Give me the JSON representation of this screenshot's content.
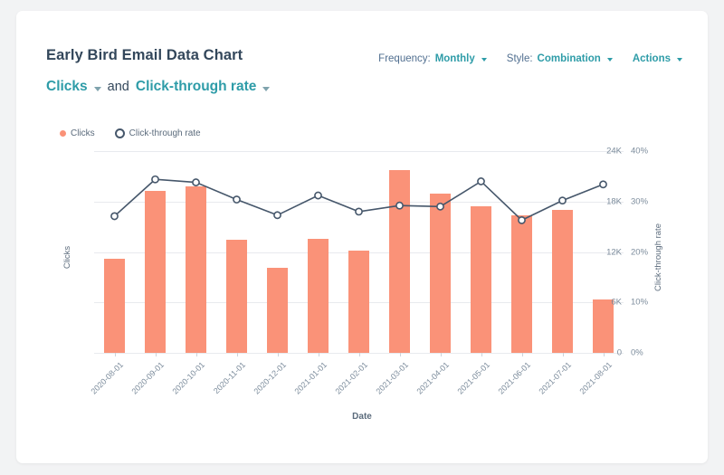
{
  "card": {
    "title": "Early Bird Email Data Chart"
  },
  "controls": [
    {
      "name": "frequency",
      "label": "Frequency:",
      "value": "Monthly",
      "icon": "chevron-down-icon"
    },
    {
      "name": "style",
      "label": "Style:",
      "value": "Combination",
      "icon": "chevron-down-icon"
    },
    {
      "name": "actions",
      "label": "",
      "value": "Actions",
      "icon": "chevron-down-icon"
    }
  ],
  "metrics": {
    "primary": "Clicks",
    "conjunction": "and",
    "secondary": "Click-through rate"
  },
  "legend": [
    {
      "label": "Clicks",
      "marker": "filled-dot",
      "color": "#fa9278"
    },
    {
      "label": "Click-through rate",
      "marker": "hollow-ring",
      "color": "#46576b"
    }
  ],
  "colors": {
    "bar": "#fa9278",
    "line": "#46576b",
    "accent": "#2e9ca8",
    "text": "#33475b",
    "axis_text": "#7c8c9c",
    "grid": "#e8eaee",
    "card": "#ffffff",
    "page": "#f2f3f4"
  },
  "chart_data": {
    "type": "bar",
    "title": "Early Bird Email Data Chart",
    "xlabel": "Date",
    "ylabel": "Clicks",
    "y2label": "Click-through rate",
    "grid": true,
    "legend_position": "top-left",
    "categories": [
      "2020-08-01",
      "2020-09-01",
      "2020-10-01",
      "2020-11-01",
      "2020-12-01",
      "2021-01-01",
      "2021-02-01",
      "2021-03-01",
      "2021-04-01",
      "2021-05-01",
      "2021-06-01",
      "2021-07-01",
      "2021-08-01"
    ],
    "ylim": [
      0,
      24000
    ],
    "yticks": [
      0,
      6000,
      12000,
      18000,
      24000
    ],
    "ytick_labels": [
      "0",
      "6K",
      "12K",
      "18K",
      "24K"
    ],
    "y2lim": [
      0,
      0.4
    ],
    "y2ticks": [
      0,
      0.1,
      0.2,
      0.3,
      0.4
    ],
    "y2tick_labels": [
      "0%",
      "10%",
      "20%",
      "30%",
      "40%"
    ],
    "series": [
      {
        "name": "Clicks",
        "type": "bar",
        "axis": "left",
        "color": "#fa9278",
        "values": [
          11200,
          19300,
          19800,
          13500,
          10100,
          13600,
          12200,
          21700,
          18900,
          17400,
          16400,
          17000,
          6400
        ]
      },
      {
        "name": "Click-through rate",
        "type": "line",
        "axis": "right",
        "color": "#46576b",
        "values": [
          27.1,
          34.4,
          33.8,
          30.4,
          27.3,
          31.2,
          28.0,
          29.2,
          29.0,
          34.0,
          26.3,
          30.2,
          33.4
        ]
      }
    ]
  }
}
